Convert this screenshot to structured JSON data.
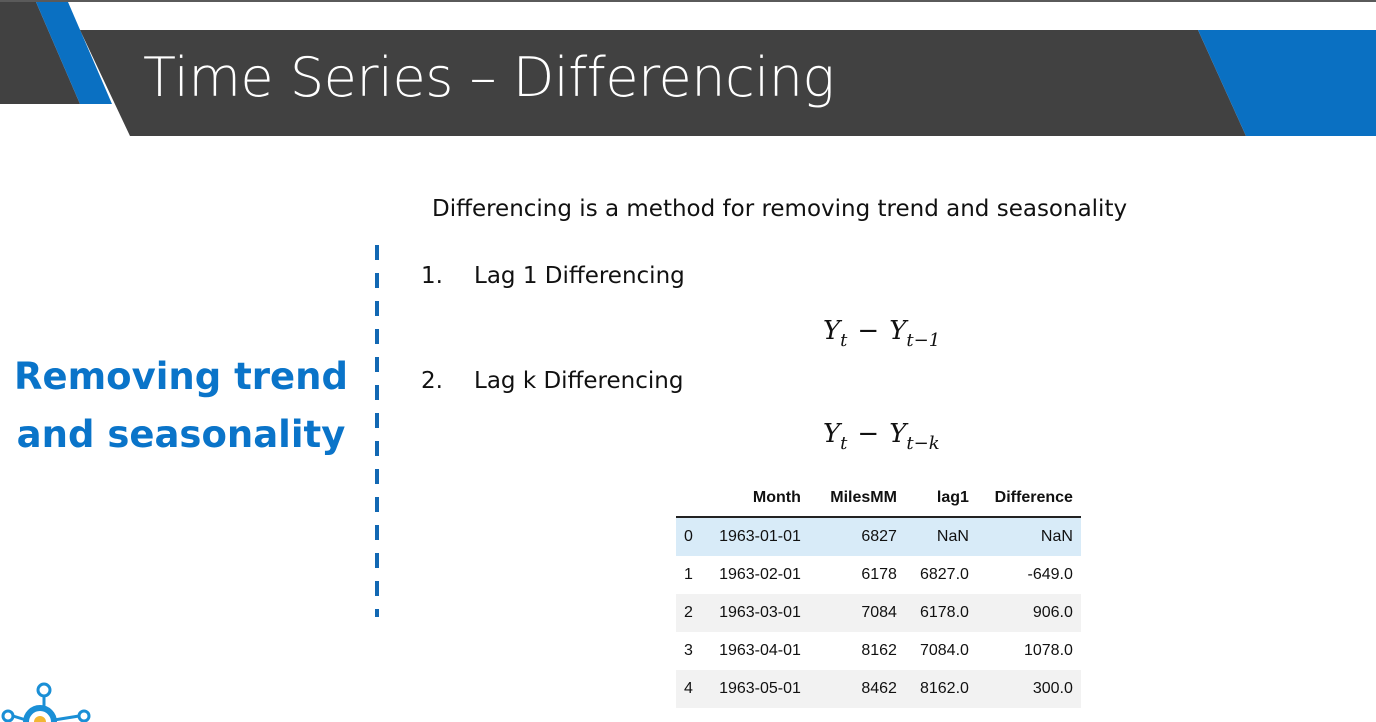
{
  "slide": {
    "title": "Time Series – Differencing",
    "side_heading": [
      "Removing trend",
      "and seasonality"
    ],
    "intro": "Differencing is a method for removing trend and seasonality",
    "items": [
      {
        "number": "1.",
        "label": "Lag 1 Differencing",
        "formula": {
          "lhs": "Y",
          "lhs_sub": "t",
          "op": "−",
          "rhs": "Y",
          "rhs_sub": "t−1"
        }
      },
      {
        "number": "2.",
        "label": "Lag k Differencing",
        "formula": {
          "lhs": "Y",
          "lhs_sub": "t",
          "op": "−",
          "rhs": "Y",
          "rhs_sub": "t−k"
        }
      }
    ]
  },
  "table": {
    "columns": [
      "",
      "Month",
      "MilesMM",
      "lag1",
      "Difference"
    ],
    "rows": [
      [
        "0",
        "1963-01-01",
        "6827",
        "NaN",
        "NaN"
      ],
      [
        "1",
        "1963-02-01",
        "6178",
        "6827.0",
        "-649.0"
      ],
      [
        "2",
        "1963-03-01",
        "7084",
        "6178.0",
        "906.0"
      ],
      [
        "3",
        "1963-04-01",
        "8162",
        "7084.0",
        "1078.0"
      ],
      [
        "4",
        "1963-05-01",
        "8462",
        "8162.0",
        "300.0"
      ]
    ]
  },
  "colors": {
    "header_bar": "#414141",
    "accent_blue": "#0a70c2",
    "heading_blue": "#0a74c9",
    "highlight_row": "#d8ebf8"
  },
  "icons": [
    "lightbulb-gear-logo-icon"
  ]
}
